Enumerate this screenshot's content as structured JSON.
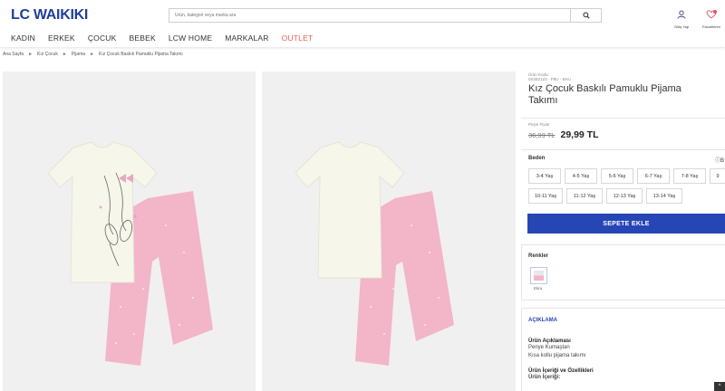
{
  "header": {
    "logo": "LC WAIKIKI",
    "search_placeholder": "Ürün, kategori veya marka ara",
    "login_label": "Giriş Yap",
    "favorites_label": "Favorilerim",
    "favorites_count": "0"
  },
  "nav": {
    "items": [
      "KADIN",
      "ERKEK",
      "ÇOCUK",
      "BEBEK",
      "LCW HOME",
      "MARKALAR",
      "OUTLET"
    ]
  },
  "breadcrumb": [
    "Ana Sayfa",
    "Kız Çocuk",
    "Pijama",
    "Kız Çocuk Baskılı Pamuklu Pijama Takımı"
  ],
  "product": {
    "code_label": "Ürün Kodu:",
    "code": "0S2821Z4 - P8U - Ekru",
    "title": "Kız Çocuk Baskılı Pamuklu Pijama Takımı",
    "price_label": "Peşin Fiyatı",
    "old_price": "36,99 TL",
    "new_price": "29,99 TL"
  },
  "sizes": {
    "label": "Beden",
    "info": "B",
    "options": [
      "3-4 Yaş",
      "4-5 Yaş",
      "5-6 Yaş",
      "6-7 Yaş",
      "7-8 Yaş",
      "8-9 Yaş",
      "9",
      "10-11 Yaş",
      "11-12 Yaş",
      "12-13 Yaş",
      "13-14 Yaş"
    ]
  },
  "cart": {
    "button": "SEPETE EKLE"
  },
  "colors": {
    "label": "Renkler",
    "selected": "Ekru"
  },
  "description": {
    "tab": "AÇIKLAMA",
    "section1_title": "Ürün Açıklaması",
    "section1_lines": [
      "Penye Kumaştan",
      "Kısa kollu pijama takımı"
    ],
    "section2_title": "Ürün İçeriği ve Özellikleri",
    "section2_sub": "Ürün İçeriği:"
  },
  "theme": {
    "brand_blue": "#1f3f99",
    "button_blue": "#2646b6",
    "outlet_red": "#e95b5b",
    "pajama_pink": "#f3b5c8",
    "shirt_cream": "#f6f7ea"
  }
}
